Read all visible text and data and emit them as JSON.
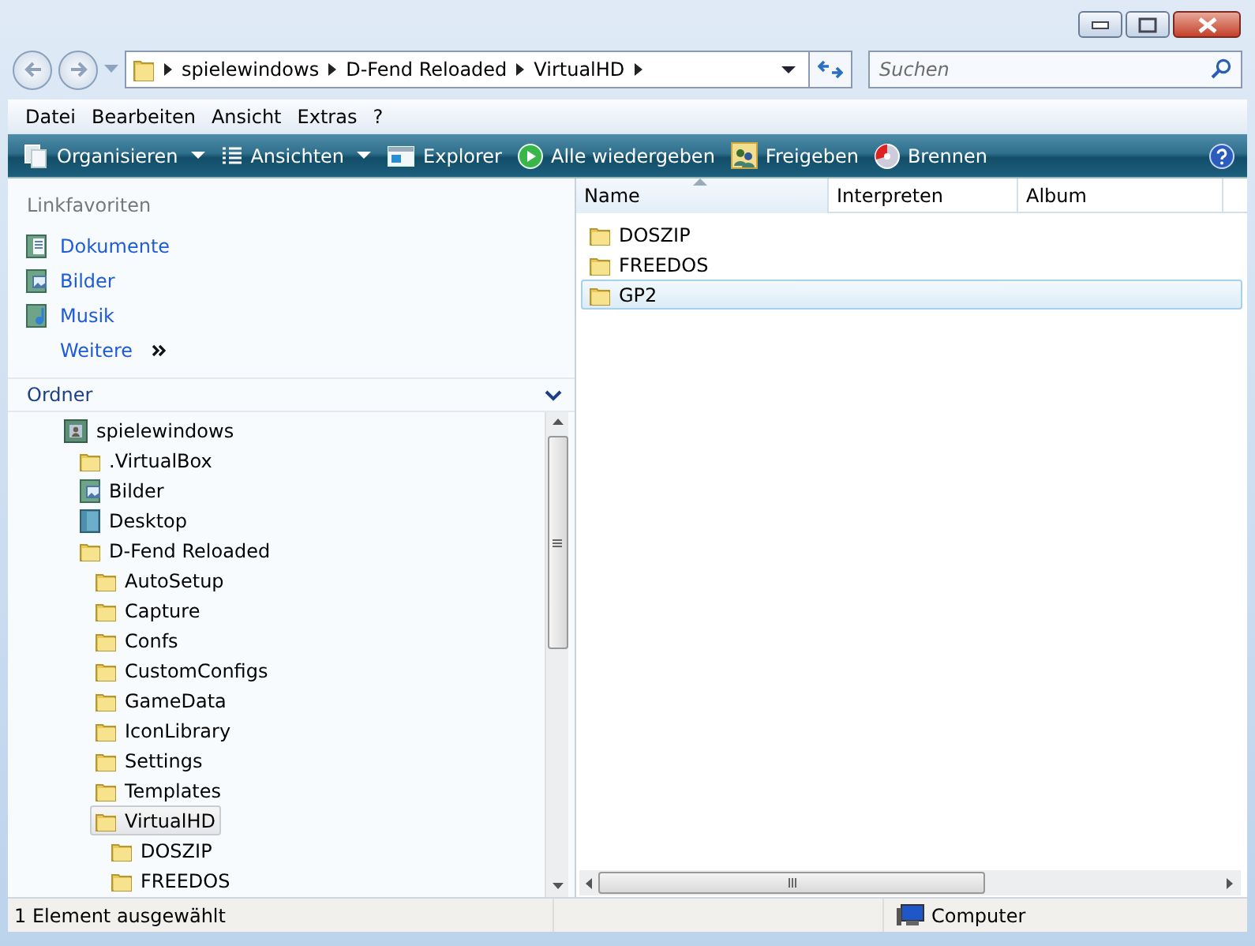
{
  "address": {
    "segments": [
      "spielewindows",
      "D-Fend Reloaded",
      "VirtualHD"
    ]
  },
  "search": {
    "placeholder": "Suchen"
  },
  "menu": [
    "Datei",
    "Bearbeiten",
    "Ansicht",
    "Extras",
    "?"
  ],
  "toolbar": [
    {
      "label": "Organisieren",
      "kind": "organize",
      "dropdown": true
    },
    {
      "label": "Ansichten",
      "kind": "views",
      "dropdown": true
    },
    {
      "label": "Explorer",
      "kind": "explorer",
      "dropdown": false
    },
    {
      "label": "Alle wiedergeben",
      "kind": "play",
      "dropdown": false
    },
    {
      "label": "Freigeben",
      "kind": "share",
      "dropdown": false
    },
    {
      "label": "Brennen",
      "kind": "burn",
      "dropdown": false
    }
  ],
  "favorites": {
    "title": "Linkfavoriten",
    "items": [
      {
        "label": "Dokumente",
        "kind": "documents"
      },
      {
        "label": "Bilder",
        "kind": "pictures"
      },
      {
        "label": "Musik",
        "kind": "music"
      }
    ],
    "more": "Weitere"
  },
  "folders": {
    "title": "Ordner",
    "tree": [
      {
        "label": "spielewindows",
        "kind": "user",
        "selected": false,
        "children": [
          {
            "label": ".VirtualBox",
            "kind": "folder",
            "selected": false
          },
          {
            "label": "Bilder",
            "kind": "pictures",
            "selected": false
          },
          {
            "label": "Desktop",
            "kind": "desktop",
            "selected": false
          },
          {
            "label": "D-Fend Reloaded",
            "kind": "folder",
            "selected": false,
            "children": [
              {
                "label": "AutoSetup",
                "kind": "folder",
                "selected": false
              },
              {
                "label": "Capture",
                "kind": "folder",
                "selected": false
              },
              {
                "label": "Confs",
                "kind": "folder",
                "selected": false
              },
              {
                "label": "CustomConfigs",
                "kind": "folder",
                "selected": false
              },
              {
                "label": "GameData",
                "kind": "folder",
                "selected": false
              },
              {
                "label": "IconLibrary",
                "kind": "folder",
                "selected": false
              },
              {
                "label": "Settings",
                "kind": "folder",
                "selected": false
              },
              {
                "label": "Templates",
                "kind": "folder",
                "selected": false
              },
              {
                "label": "VirtualHD",
                "kind": "folder",
                "selected": true,
                "children": [
                  {
                    "label": "DOSZIP",
                    "kind": "folder",
                    "selected": false
                  },
                  {
                    "label": "FREEDOS",
                    "kind": "folder",
                    "selected": false
                  }
                ]
              }
            ]
          }
        ]
      }
    ]
  },
  "files": {
    "columns": [
      "Name",
      "Interpreten",
      "Album"
    ],
    "rows": [
      {
        "name": "DOSZIP",
        "selected": false
      },
      {
        "name": "FREEDOS",
        "selected": false
      },
      {
        "name": "GP2",
        "selected": true
      }
    ]
  },
  "status_bar": {
    "text": "1 Element ausgewählt",
    "location": "Computer"
  }
}
